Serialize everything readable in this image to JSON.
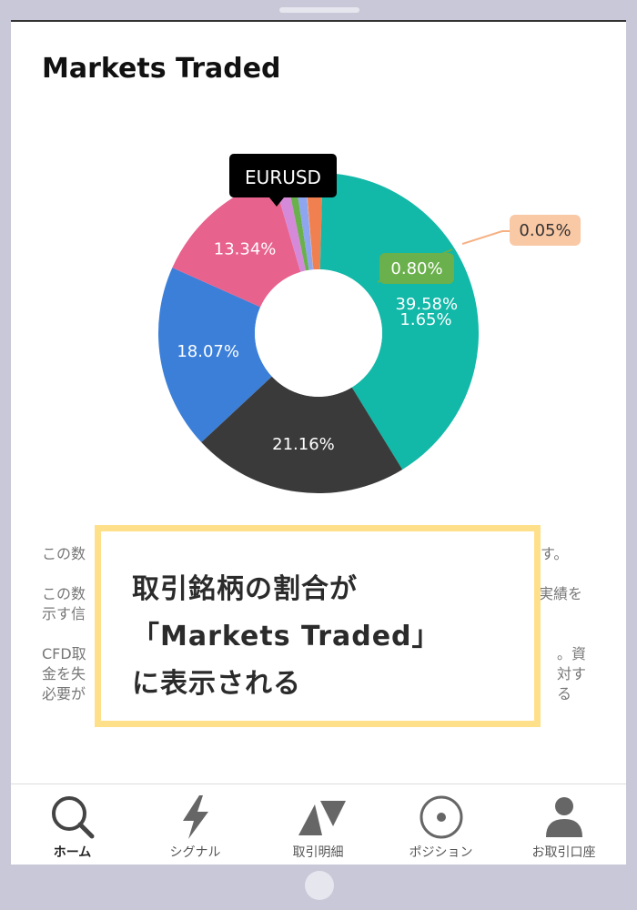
{
  "page": {
    "title": "Markets Traded"
  },
  "chart_data": {
    "type": "pie",
    "donut": true,
    "title": "Markets Traded",
    "slices": [
      {
        "label": "18.07%",
        "value": 18.07,
        "color": "#3b7fd9"
      },
      {
        "label": "13.34%",
        "value": 13.34,
        "color": "#e8628e"
      },
      {
        "label": "",
        "value": 1.3,
        "color": "#d58ad9"
      },
      {
        "label": "0.80%",
        "value": 0.8,
        "color": "#6ab04c"
      },
      {
        "label": "",
        "value": 1.0,
        "color": "#8ea6f0"
      },
      {
        "label": "0.05%",
        "value": 0.05,
        "color": "#f6b183"
      },
      {
        "label": "1.65%",
        "value": 1.65,
        "color": "#f08050"
      },
      {
        "label": "39.58%",
        "value": 39.58,
        "color": "#12b8a8"
      },
      {
        "label": "21.16%",
        "value": 21.16,
        "color": "#3a3a3a"
      }
    ],
    "tooltip": "EURUSD"
  },
  "body": {
    "line1": "この数",
    "line1_end": "す。",
    "line2a": "この数",
    "line2a_end": "実績を",
    "line2b": "示す信",
    "line3a": "CFD取",
    "line3a_end": "。資",
    "line3b": "金を失",
    "line3b_end": "対する",
    "line3c": "必要が"
  },
  "overlay": {
    "line1": "取引銘柄の割合が",
    "line2": "「Markets Traded」",
    "line3": "に表示される"
  },
  "tabs": [
    {
      "label": "ホーム",
      "icon": "search-icon"
    },
    {
      "label": "シグナル",
      "icon": "lightning-icon"
    },
    {
      "label": "取引明細",
      "icon": "trades-icon"
    },
    {
      "label": "ポジション",
      "icon": "target-icon"
    },
    {
      "label": "お取引口座",
      "icon": "user-icon"
    }
  ]
}
